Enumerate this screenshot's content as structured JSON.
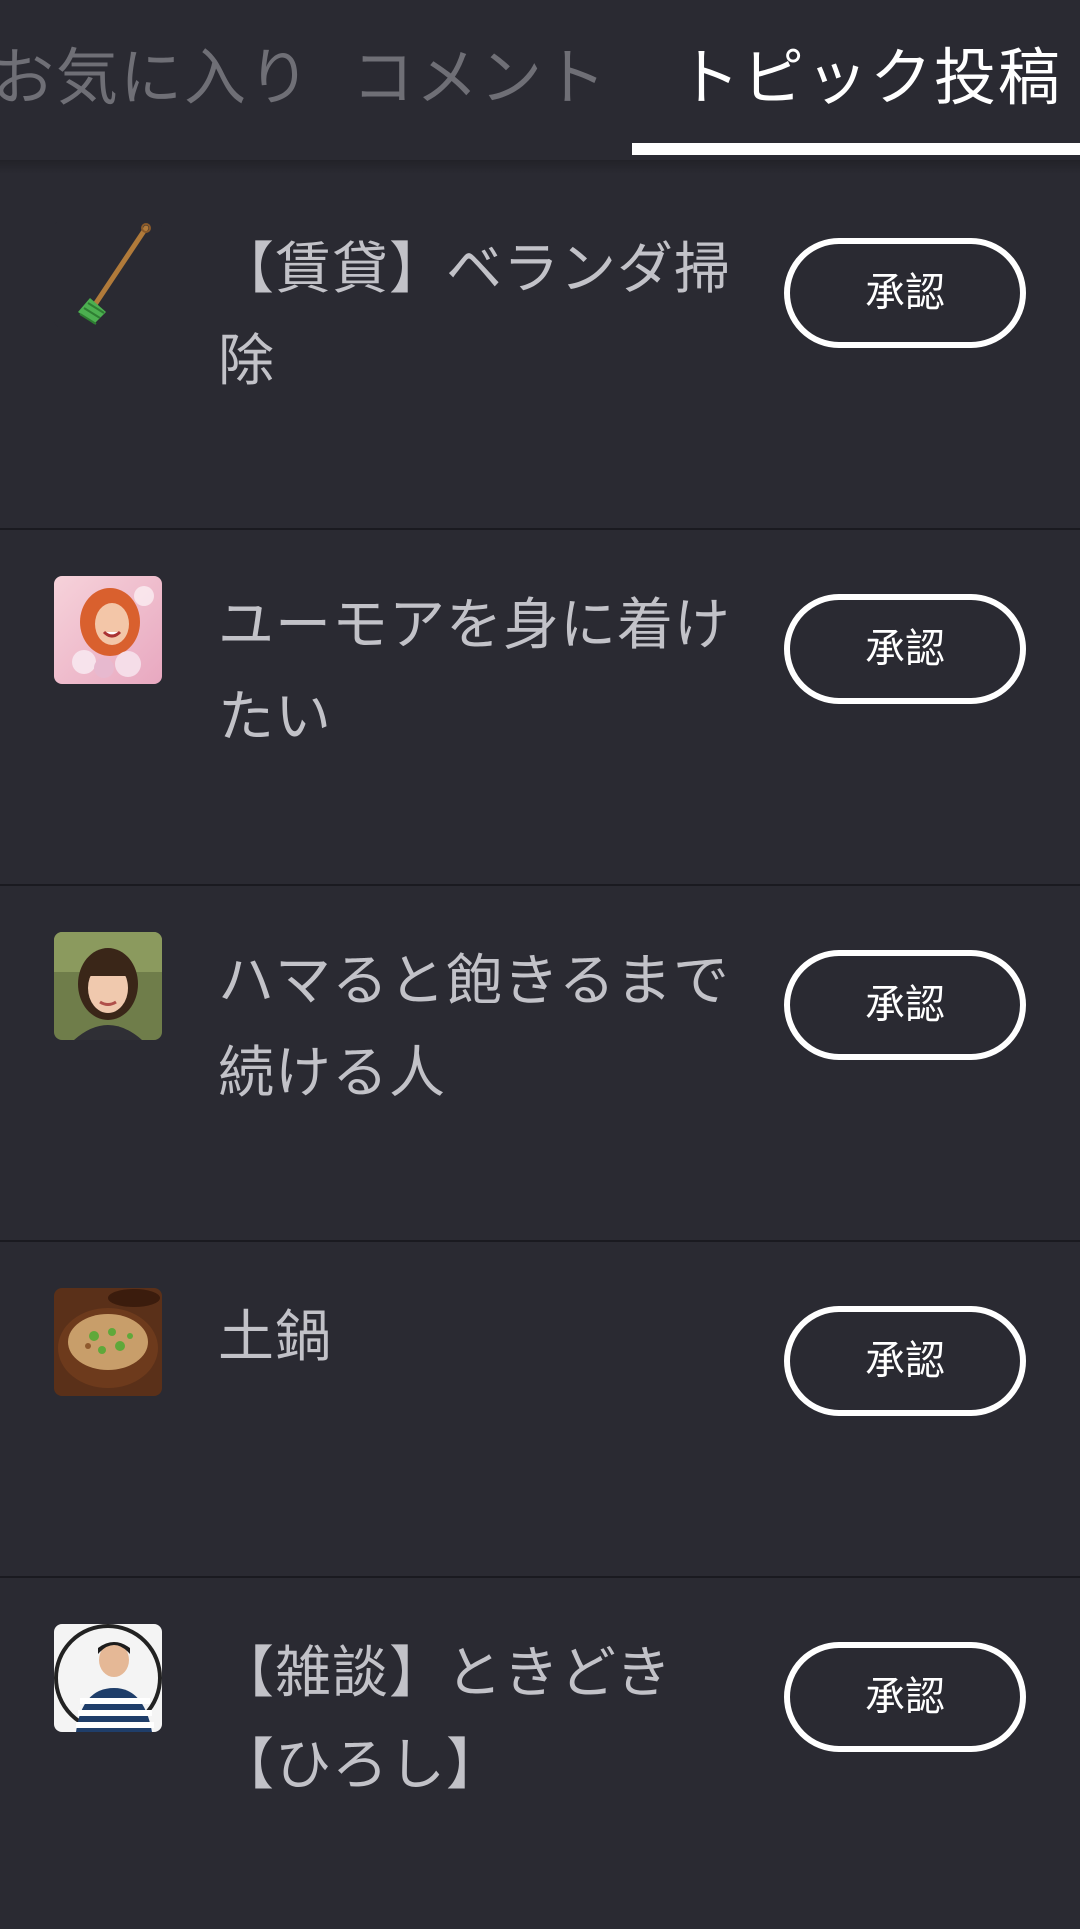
{
  "tabs": {
    "favorites": "お気に入り",
    "comments": "コメント",
    "topics": "トピック投稿"
  },
  "topics": [
    {
      "title": "【賃貸】ベランダ掃除",
      "button": "承認",
      "thumbnail": "broom-icon"
    },
    {
      "title": "ユーモアを身に着けたい",
      "button": "承認",
      "thumbnail": "laughing-woman-photo"
    },
    {
      "title": "ハマると飽きるまで続ける人",
      "button": "承認",
      "thumbnail": "woman-portrait-photo"
    },
    {
      "title": "土鍋",
      "button": "承認",
      "thumbnail": "clay-pot-rice-photo"
    },
    {
      "title": "【雑談】ときどき【ひろし】",
      "button": "承認",
      "thumbnail": "man-striped-shirt-photo"
    }
  ],
  "colors": {
    "background": "#2a2a32",
    "active_tab": "#ffffff",
    "inactive_tab": "#6f6f76",
    "title_text": "#c2c2c8"
  }
}
